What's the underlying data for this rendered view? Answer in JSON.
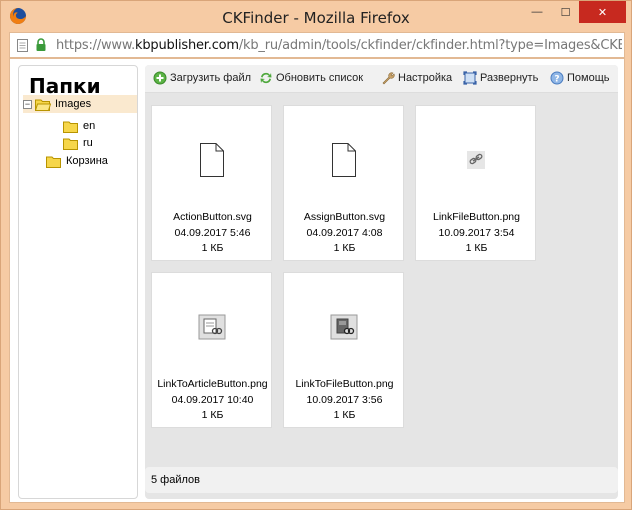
{
  "window": {
    "title": "CKFinder - Mozilla Firefox",
    "controls": {
      "minimize": "—",
      "maximize": "☐",
      "close": "✕"
    }
  },
  "urlbar": {
    "prefix": "https://www.",
    "host": "kbpublisher.com",
    "path": "/kb_ru/admin/tools/ckfinder/ckfinder.html?type=Images&CKEditor=body&"
  },
  "sidebar": {
    "title": "Папки",
    "tree": [
      {
        "label": "Images",
        "toggle": "−",
        "selected": true
      },
      {
        "label": "en"
      },
      {
        "label": "ru"
      },
      {
        "label": "Корзина"
      }
    ]
  },
  "toolbar": {
    "items": [
      {
        "label": "Загрузить файл",
        "icon": "upload-icon"
      },
      {
        "label": "Обновить список",
        "icon": "refresh-icon"
      },
      {
        "label": "Настройка",
        "icon": "wrench-icon"
      },
      {
        "label": "Развернуть",
        "icon": "maximize-icon"
      },
      {
        "label": "Помощь",
        "icon": "help-icon"
      }
    ]
  },
  "files": [
    {
      "name": "ActionButton.svg",
      "date": "04.09.2017 5:46",
      "size": "1 КБ",
      "thumb": "blank-file-icon"
    },
    {
      "name": "AssignButton.svg",
      "date": "04.09.2017 4:08",
      "size": "1 КБ",
      "thumb": "blank-file-icon"
    },
    {
      "name": "LinkFileButton.png",
      "date": "10.09.2017 3:54",
      "size": "1 КБ",
      "thumb": "link-icon"
    },
    {
      "name": "LinkToArticleButton.png",
      "date": "04.09.2017 10:40",
      "size": "1 КБ",
      "thumb": "link-article-icon"
    },
    {
      "name": "LinkToFileButton.png",
      "date": "10.09.2017 3:56",
      "size": "1 КБ",
      "thumb": "link-file-icon"
    }
  ],
  "status": {
    "text": "5 файлов"
  },
  "colors": {
    "titlebar": "#f6cba4",
    "close": "#c7291f",
    "selected": "#fae9cf",
    "folder": "#f6d64a"
  }
}
